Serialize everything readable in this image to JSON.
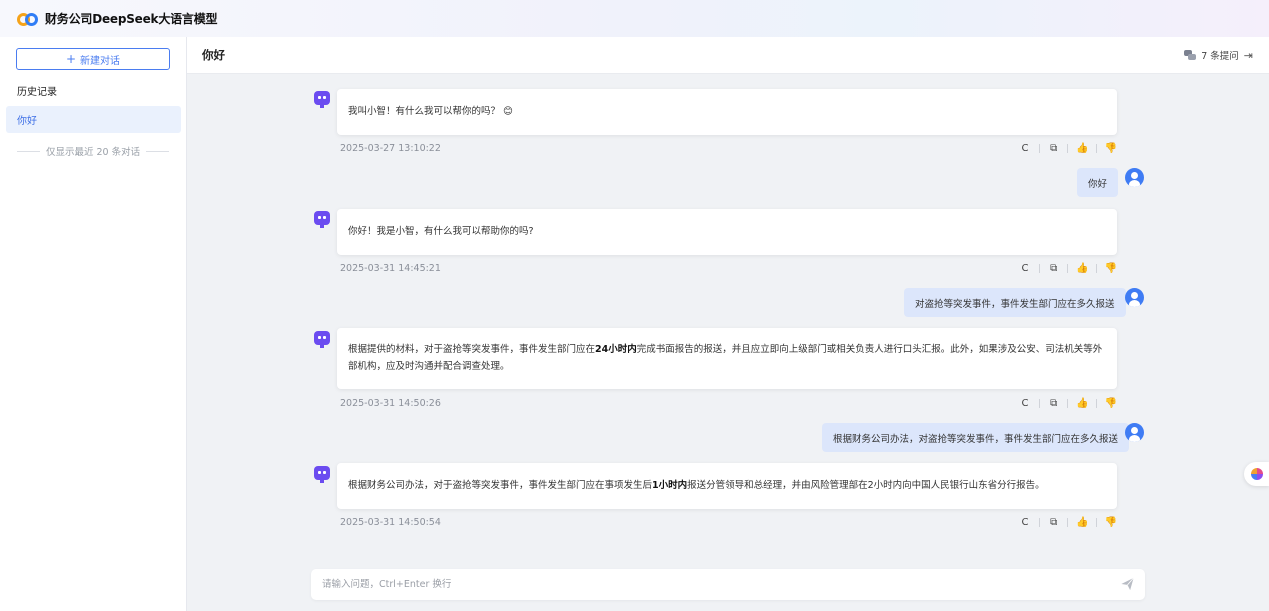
{
  "app": {
    "title": "财务公司DeepSeek大语言模型"
  },
  "sidebar": {
    "new_chat_label": "新建对话",
    "history_label": "历史记录",
    "items": [
      {
        "label": "你好"
      }
    ],
    "note": "仅显示最近 20 条对话"
  },
  "topbar": {
    "conversation_title": "你好",
    "question_count": "7 条提问"
  },
  "messages": [
    {
      "role": "bot",
      "text": "我叫小智！有什么我可以帮你的吗？ 😊",
      "time": "2025-03-27 13:10:22"
    },
    {
      "role": "user",
      "text": "你好"
    },
    {
      "role": "bot",
      "text": "你好！我是小智，有什么我可以帮助你的吗?",
      "time": "2025-03-31 14:45:21"
    },
    {
      "role": "user",
      "text": "对盗抢等突发事件，事件发生部门应在多久报送"
    },
    {
      "role": "bot",
      "text_parts": [
        "根据提供的材料，对于盗抢等突发事件，事件发生部门应在",
        "24小时内",
        "完成书面报告的报送，并且应立即向上级部门或相关负责人进行口头汇报。此外，如果涉及公安、司法机关等外部机构，应及时沟通并配合调查处理。"
      ],
      "time": "2025-03-31 14:50:26"
    },
    {
      "role": "user",
      "text": "根据财务公司办法，对盗抢等突发事件，事件发生部门应在多久报送"
    },
    {
      "role": "bot",
      "text_parts": [
        "根据财务公司办法，对于盗抢等突发事件，事件发生部门应在事项发生后",
        "1小时内",
        "报送分管领导和总经理，并由风险管理部在2小时内向中国人民银行山东省分行报告。"
      ],
      "time": "2025-03-31 14:50:54"
    }
  ],
  "actions": {
    "refresh": "C",
    "copy": "⧉",
    "like": "👍",
    "dislike": "👎"
  },
  "input": {
    "placeholder": "请输入问题，Ctrl+Enter 换行"
  },
  "colors": {
    "accent": "#4a7cf0",
    "bot_avatar": "#6b4cf0",
    "user_bubble": "#dce6fb"
  }
}
